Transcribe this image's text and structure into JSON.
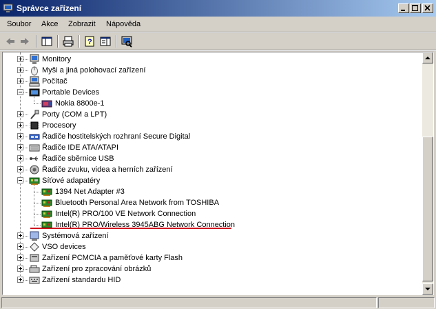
{
  "window": {
    "title": "Správce zařízení"
  },
  "menu": {
    "items": [
      "Soubor",
      "Akce",
      "Zobrazit",
      "Nápověda"
    ]
  },
  "tree": [
    {
      "label": "Monitory",
      "level": 0,
      "icon": "monitor-icon",
      "expander": "plus"
    },
    {
      "label": "Myši a jiná polohovací zařízení",
      "level": 0,
      "icon": "mouse-icon",
      "expander": "plus"
    },
    {
      "label": "Počítač",
      "level": 0,
      "icon": "computer-icon",
      "expander": "plus"
    },
    {
      "label": "Portable Devices",
      "level": 0,
      "icon": "portable-device-icon",
      "expander": "minus"
    },
    {
      "label": "Nokia 8800e-1",
      "level": 1,
      "icon": "phone-icon",
      "expander": "none"
    },
    {
      "label": "Porty (COM a LPT)",
      "level": 0,
      "icon": "port-icon",
      "expander": "plus"
    },
    {
      "label": "Procesory",
      "level": 0,
      "icon": "processor-icon",
      "expander": "plus"
    },
    {
      "label": "Řadiče hostitelských rozhraní Secure Digital",
      "level": 0,
      "icon": "sd-controller-icon",
      "expander": "plus"
    },
    {
      "label": "Řadiče IDE ATA/ATAPI",
      "level": 0,
      "icon": "ide-controller-icon",
      "expander": "plus"
    },
    {
      "label": "Řadiče sběrnice USB",
      "level": 0,
      "icon": "usb-icon",
      "expander": "plus"
    },
    {
      "label": "Řadiče zvuku, videa a herních zařízení",
      "level": 0,
      "icon": "sound-icon",
      "expander": "plus"
    },
    {
      "label": "Síťové adapatéry",
      "level": 0,
      "icon": "network-adapter-icon",
      "expander": "minus"
    },
    {
      "label": "1394 Net Adapter #3",
      "level": 1,
      "icon": "network-card-icon",
      "expander": "none"
    },
    {
      "label": "Bluetooth Personal Area Network from TOSHIBA",
      "level": 1,
      "icon": "network-card-icon",
      "expander": "none"
    },
    {
      "label": "Intel(R) PRO/100 VE Network Connection",
      "level": 1,
      "icon": "network-card-icon",
      "expander": "none"
    },
    {
      "label": "Intel(R) PRO/Wireless 3945ABG Network Connection",
      "level": 1,
      "icon": "network-card-icon",
      "expander": "none"
    },
    {
      "label": "Systémová zařízení",
      "level": 0,
      "icon": "system-device-icon",
      "expander": "plus"
    },
    {
      "label": "VSO devices",
      "level": 0,
      "icon": "vso-device-icon",
      "expander": "plus"
    },
    {
      "label": "Zařízení PCMCIA a paměťové karty Flash",
      "level": 0,
      "icon": "pcmcia-icon",
      "expander": "plus"
    },
    {
      "label": "Zařízení pro zpracování obrázků",
      "level": 0,
      "icon": "imaging-device-icon",
      "expander": "plus"
    },
    {
      "label": "Zařízení standardu HID",
      "level": 0,
      "icon": "hid-icon",
      "expander": "plus"
    }
  ],
  "colors": {
    "title_active": "#0a246a",
    "highlight_underline": "#d0141e"
  }
}
